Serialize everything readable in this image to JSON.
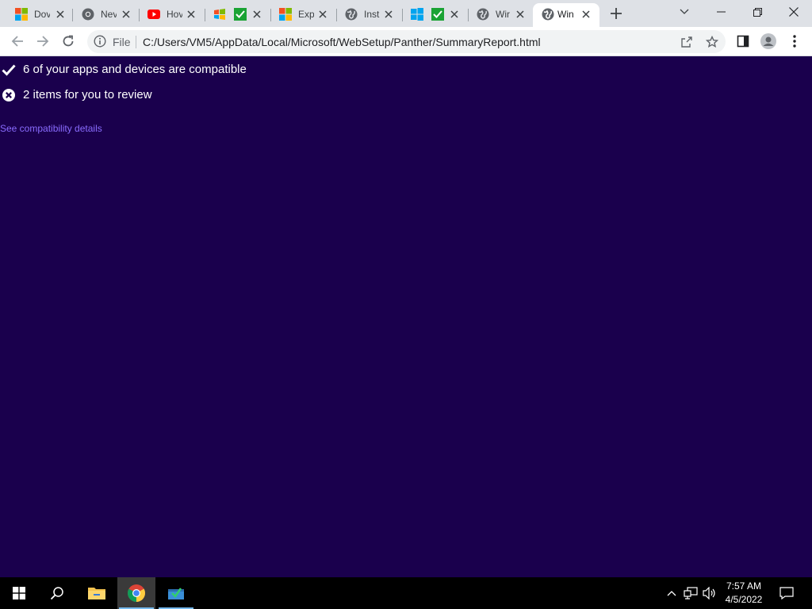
{
  "browser": {
    "tabs": [
      {
        "title": "Dov",
        "favicon": "windows-logo-icon"
      },
      {
        "title": "Nev",
        "favicon": "chrome-icon"
      },
      {
        "title": "Hov",
        "favicon": "youtube-icon"
      },
      {
        "title": "",
        "favicon": "windows-flag-icon",
        "extra_icon": "green-check-icon"
      },
      {
        "title": "Exp",
        "favicon": "windows-logo-icon"
      },
      {
        "title": "Inst",
        "favicon": "globe-icon"
      },
      {
        "title": "",
        "favicon": "windows-blue-icon",
        "extra_icon": "green-check-icon"
      },
      {
        "title": "Wir",
        "favicon": "globe-icon"
      },
      {
        "title": "Win",
        "favicon": "globe-icon",
        "active": true
      }
    ],
    "address": {
      "scheme_label": "File",
      "url": "C:/Users/VM5/AppData/Local/Microsoft/WebSetup/Panther/SummaryReport.html"
    }
  },
  "page": {
    "compatible_text": "6 of your apps and devices are compatible",
    "review_text": "2 items for you to review",
    "details_link": "See compatibility details"
  },
  "taskbar": {
    "time": "7:57 AM",
    "date": "4/5/2022"
  },
  "colors": {
    "page_background": "#1a004d",
    "link": "#8a6cff"
  }
}
